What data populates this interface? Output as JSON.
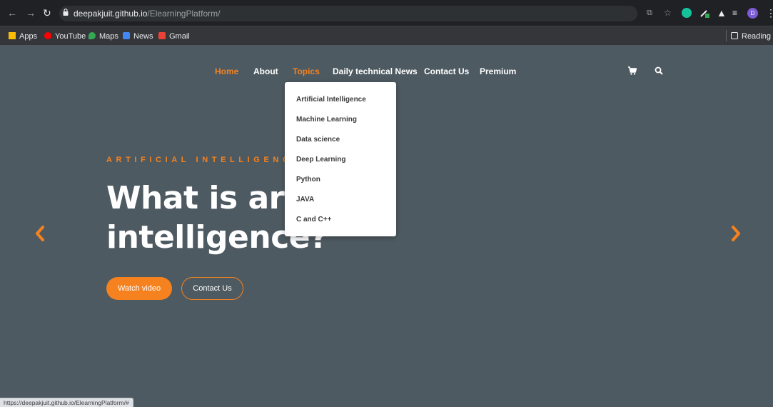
{
  "browser": {
    "url_host": "deepakjuit.github.io",
    "url_path": "/ElearningPlatform/",
    "profile_initial": "D",
    "reading_list": "Reading list",
    "bookmarks": [
      {
        "label": "Apps",
        "icon": "apps-grid-icon"
      },
      {
        "label": "YouTube",
        "icon": "youtube-icon"
      },
      {
        "label": "Maps",
        "icon": "maps-icon"
      },
      {
        "label": "News",
        "icon": "news-icon"
      },
      {
        "label": "Gmail",
        "icon": "gmail-icon"
      }
    ],
    "status_url": "https://deepakjuit.github.io/ElearningPlatform/#"
  },
  "nav": {
    "items": [
      "Home",
      "About",
      "Topics",
      "Daily technical News",
      "Contact Us",
      "Premium"
    ],
    "active": "Home"
  },
  "dropdown": {
    "items": [
      "Artificial Intelligence",
      "Machine Learning",
      "Data science",
      "Deep Learning",
      "Python",
      "JAVA",
      "C and C++"
    ]
  },
  "hero": {
    "eyebrow": "ARTIFICIAL INTELLIGENCE",
    "title": "What is artificial intelligence?",
    "primary_button": "Watch video",
    "secondary_button": "Contact Us"
  },
  "colors": {
    "accent": "#f5821f",
    "background": "#4e5a61",
    "chrome": "#202124"
  }
}
